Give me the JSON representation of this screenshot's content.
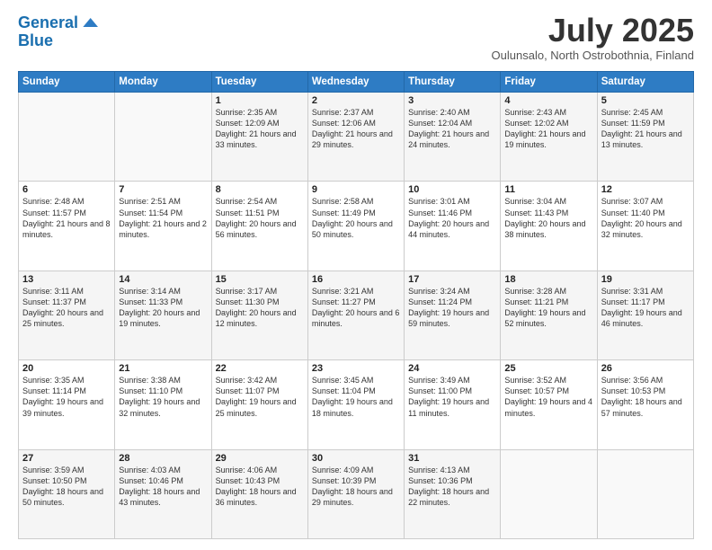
{
  "header": {
    "logo_line1": "General",
    "logo_line2": "Blue",
    "month_title": "July 2025",
    "subtitle": "Oulunsalo, North Ostrobothnia, Finland"
  },
  "weekdays": [
    "Sunday",
    "Monday",
    "Tuesday",
    "Wednesday",
    "Thursday",
    "Friday",
    "Saturday"
  ],
  "weeks": [
    [
      {
        "day": "",
        "info": ""
      },
      {
        "day": "",
        "info": ""
      },
      {
        "day": "1",
        "info": "Sunrise: 2:35 AM\nSunset: 12:09 AM\nDaylight: 21 hours and 33 minutes."
      },
      {
        "day": "2",
        "info": "Sunrise: 2:37 AM\nSunset: 12:06 AM\nDaylight: 21 hours and 29 minutes."
      },
      {
        "day": "3",
        "info": "Sunrise: 2:40 AM\nSunset: 12:04 AM\nDaylight: 21 hours and 24 minutes."
      },
      {
        "day": "4",
        "info": "Sunrise: 2:43 AM\nSunset: 12:02 AM\nDaylight: 21 hours and 19 minutes."
      },
      {
        "day": "5",
        "info": "Sunrise: 2:45 AM\nSunset: 11:59 PM\nDaylight: 21 hours and 13 minutes."
      }
    ],
    [
      {
        "day": "6",
        "info": "Sunrise: 2:48 AM\nSunset: 11:57 PM\nDaylight: 21 hours and 8 minutes."
      },
      {
        "day": "7",
        "info": "Sunrise: 2:51 AM\nSunset: 11:54 PM\nDaylight: 21 hours and 2 minutes."
      },
      {
        "day": "8",
        "info": "Sunrise: 2:54 AM\nSunset: 11:51 PM\nDaylight: 20 hours and 56 minutes."
      },
      {
        "day": "9",
        "info": "Sunrise: 2:58 AM\nSunset: 11:49 PM\nDaylight: 20 hours and 50 minutes."
      },
      {
        "day": "10",
        "info": "Sunrise: 3:01 AM\nSunset: 11:46 PM\nDaylight: 20 hours and 44 minutes."
      },
      {
        "day": "11",
        "info": "Sunrise: 3:04 AM\nSunset: 11:43 PM\nDaylight: 20 hours and 38 minutes."
      },
      {
        "day": "12",
        "info": "Sunrise: 3:07 AM\nSunset: 11:40 PM\nDaylight: 20 hours and 32 minutes."
      }
    ],
    [
      {
        "day": "13",
        "info": "Sunrise: 3:11 AM\nSunset: 11:37 PM\nDaylight: 20 hours and 25 minutes."
      },
      {
        "day": "14",
        "info": "Sunrise: 3:14 AM\nSunset: 11:33 PM\nDaylight: 20 hours and 19 minutes."
      },
      {
        "day": "15",
        "info": "Sunrise: 3:17 AM\nSunset: 11:30 PM\nDaylight: 20 hours and 12 minutes."
      },
      {
        "day": "16",
        "info": "Sunrise: 3:21 AM\nSunset: 11:27 PM\nDaylight: 20 hours and 6 minutes."
      },
      {
        "day": "17",
        "info": "Sunrise: 3:24 AM\nSunset: 11:24 PM\nDaylight: 19 hours and 59 minutes."
      },
      {
        "day": "18",
        "info": "Sunrise: 3:28 AM\nSunset: 11:21 PM\nDaylight: 19 hours and 52 minutes."
      },
      {
        "day": "19",
        "info": "Sunrise: 3:31 AM\nSunset: 11:17 PM\nDaylight: 19 hours and 46 minutes."
      }
    ],
    [
      {
        "day": "20",
        "info": "Sunrise: 3:35 AM\nSunset: 11:14 PM\nDaylight: 19 hours and 39 minutes."
      },
      {
        "day": "21",
        "info": "Sunrise: 3:38 AM\nSunset: 11:10 PM\nDaylight: 19 hours and 32 minutes."
      },
      {
        "day": "22",
        "info": "Sunrise: 3:42 AM\nSunset: 11:07 PM\nDaylight: 19 hours and 25 minutes."
      },
      {
        "day": "23",
        "info": "Sunrise: 3:45 AM\nSunset: 11:04 PM\nDaylight: 19 hours and 18 minutes."
      },
      {
        "day": "24",
        "info": "Sunrise: 3:49 AM\nSunset: 11:00 PM\nDaylight: 19 hours and 11 minutes."
      },
      {
        "day": "25",
        "info": "Sunrise: 3:52 AM\nSunset: 10:57 PM\nDaylight: 19 hours and 4 minutes."
      },
      {
        "day": "26",
        "info": "Sunrise: 3:56 AM\nSunset: 10:53 PM\nDaylight: 18 hours and 57 minutes."
      }
    ],
    [
      {
        "day": "27",
        "info": "Sunrise: 3:59 AM\nSunset: 10:50 PM\nDaylight: 18 hours and 50 minutes."
      },
      {
        "day": "28",
        "info": "Sunrise: 4:03 AM\nSunset: 10:46 PM\nDaylight: 18 hours and 43 minutes."
      },
      {
        "day": "29",
        "info": "Sunrise: 4:06 AM\nSunset: 10:43 PM\nDaylight: 18 hours and 36 minutes."
      },
      {
        "day": "30",
        "info": "Sunrise: 4:09 AM\nSunset: 10:39 PM\nDaylight: 18 hours and 29 minutes."
      },
      {
        "day": "31",
        "info": "Sunrise: 4:13 AM\nSunset: 10:36 PM\nDaylight: 18 hours and 22 minutes."
      },
      {
        "day": "",
        "info": ""
      },
      {
        "day": "",
        "info": ""
      }
    ]
  ]
}
